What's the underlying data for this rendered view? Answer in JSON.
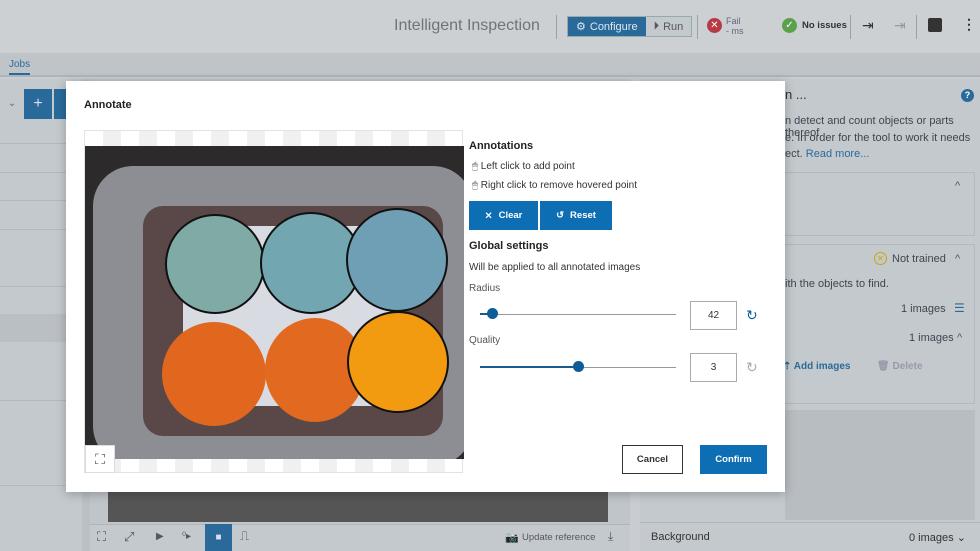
{
  "header": {
    "title": "Intelligent Inspection",
    "configure": "Configure",
    "run": "Run",
    "fail": "Fail",
    "fail_time": "- ms",
    "status": "No issues"
  },
  "tabs": {
    "jobs": "Jobs"
  },
  "right_panel": {
    "title_tail": "n",
    "more": "...",
    "desc1": "n detect and count objects or parts thereof",
    "desc2": "e. In order for the tool to work it needs",
    "desc3": "ect.",
    "read_more": "Read more...",
    "not_trained": "Not trained",
    "objects_text": "ith the objects to find.",
    "images1": "1 images",
    "images2": "1 images",
    "add_images": "Add images",
    "delete": "Delete",
    "background": "Background",
    "bg_images": "0 images"
  },
  "bottom_toolbar": {
    "update_reference": "Update reference"
  },
  "modal": {
    "title": "Annotate",
    "annotations_heading": "Annotations",
    "hint_left": "Left click to add point",
    "hint_right": "Right click to remove hovered point",
    "clear": "Clear",
    "reset": "Reset",
    "global_heading": "Global settings",
    "global_desc": "Will be applied to all annotated images",
    "radius_label": "Radius",
    "radius_value": "42",
    "radius_fraction": 0.04,
    "quality_label": "Quality",
    "quality_value": "3",
    "quality_fraction": 0.5,
    "cancel": "Cancel",
    "confirm": "Confirm"
  },
  "colors": {
    "accent": "#0d6eb4",
    "fail": "#c0392b",
    "ok": "#4caf50",
    "warning": "#d4b200"
  }
}
